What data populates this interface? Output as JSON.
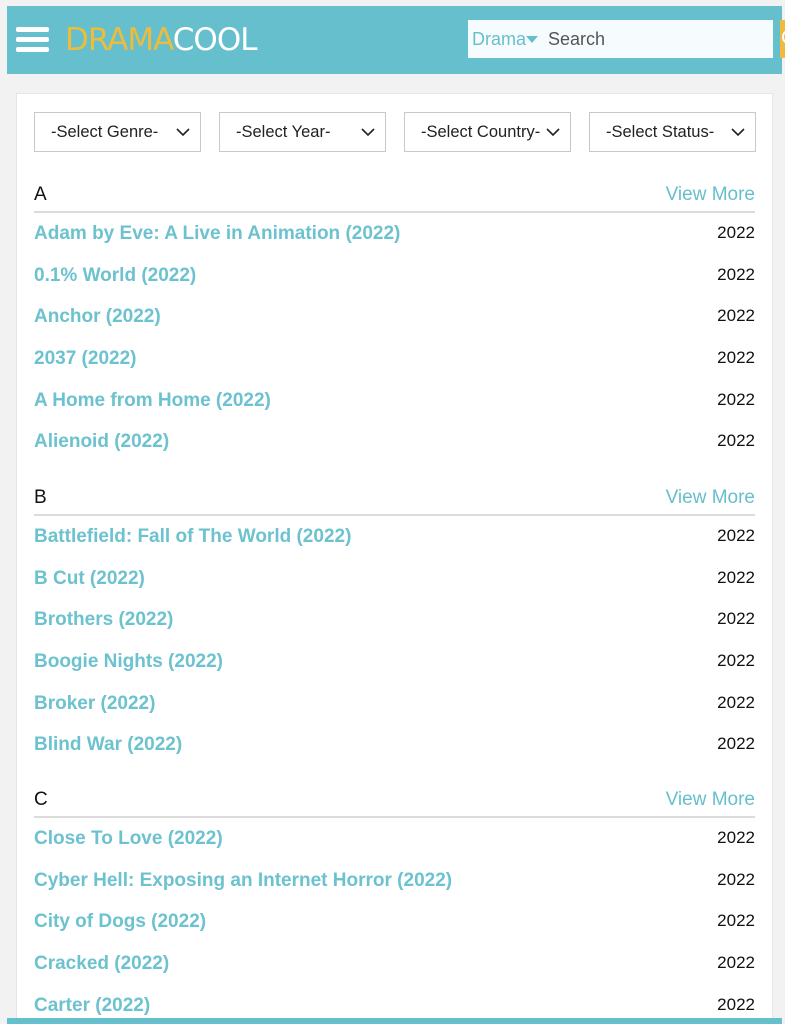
{
  "header": {
    "logo_part1": "DRAMA",
    "logo_part2": "COOL",
    "search_type": "Drama",
    "search_placeholder": "Search",
    "colors": {
      "header_bg": "#66bfcc",
      "logo_accent": "#ecbd3c",
      "search_button": "#f2b93e",
      "link": "#6cc2cf"
    }
  },
  "filters": [
    {
      "label": "-Select Genre-"
    },
    {
      "label": "-Select Year-"
    },
    {
      "label": "-Select Country-"
    },
    {
      "label": "-Select Status-"
    }
  ],
  "sections": [
    {
      "letter": "A",
      "view_more": "View More",
      "items": [
        {
          "title": "Adam by Eve: A Live in Animation (2022)",
          "year": "2022"
        },
        {
          "title": "0.1% World (2022)",
          "year": "2022"
        },
        {
          "title": "Anchor (2022)",
          "year": "2022"
        },
        {
          "title": "2037 (2022)",
          "year": "2022"
        },
        {
          "title": "A Home from Home (2022)",
          "year": "2022"
        },
        {
          "title": "Alienoid (2022)",
          "year": "2022"
        }
      ]
    },
    {
      "letter": "B",
      "view_more": "View More",
      "items": [
        {
          "title": "Battlefield: Fall of The World (2022)",
          "year": "2022"
        },
        {
          "title": "B Cut (2022)",
          "year": "2022"
        },
        {
          "title": "Brothers (2022)",
          "year": "2022"
        },
        {
          "title": "Boogie Nights (2022)",
          "year": "2022"
        },
        {
          "title": "Broker (2022)",
          "year": "2022"
        },
        {
          "title": "Blind War (2022)",
          "year": "2022"
        }
      ]
    },
    {
      "letter": "C",
      "view_more": "View More",
      "items": [
        {
          "title": "Close To Love (2022)",
          "year": "2022"
        },
        {
          "title": "Cyber Hell: Exposing an Internet Horror (2022)",
          "year": "2022"
        },
        {
          "title": "City of Dogs (2022)",
          "year": "2022"
        },
        {
          "title": "Cracked (2022)",
          "year": "2022"
        },
        {
          "title": "Carter (2022)",
          "year": "2022"
        }
      ]
    }
  ]
}
